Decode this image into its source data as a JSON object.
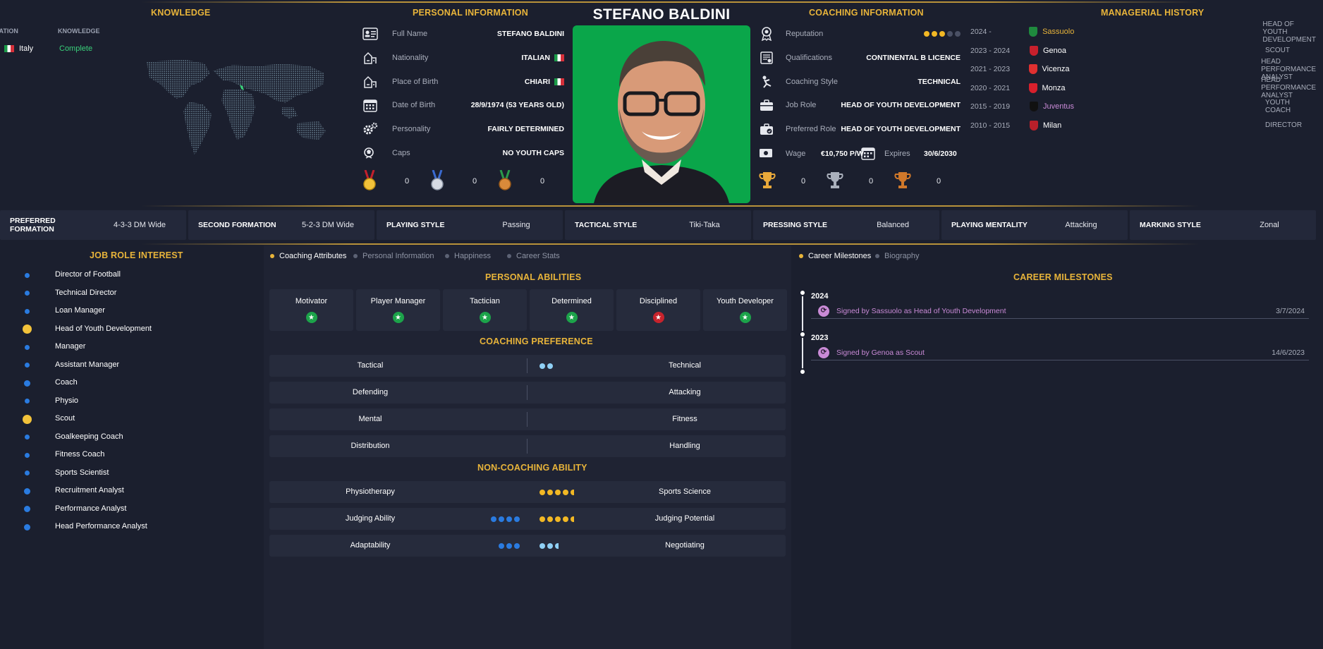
{
  "header": {
    "name": "STEFANO BALDINI"
  },
  "knowledge": {
    "title": "KNOWLEDGE",
    "col_nation": "NATION",
    "col_knowledge": "KNOWLEDGE",
    "rows": [
      {
        "nation": "Italy",
        "knowledge": "Complete"
      }
    ],
    "complete_color": "#39d07a"
  },
  "personal": {
    "title": "PERSONAL INFORMATION",
    "rows": [
      {
        "icon": "id-card-icon",
        "label": "Full Name",
        "value": "STEFANO BALDINI"
      },
      {
        "icon": "nationality-icon",
        "label": "Nationality",
        "value": "ITALIAN"
      },
      {
        "icon": "birthplace-icon",
        "label": "Place of Birth",
        "value": "CHIARI"
      },
      {
        "icon": "calendar-icon",
        "label": "Date of Birth",
        "value": "28/9/1974 (53 YEARS OLD)"
      },
      {
        "icon": "gears-icon",
        "label": "Personality",
        "value": "FAIRLY DETERMINED"
      },
      {
        "icon": "cap-icon",
        "label": "Caps",
        "value": "NO YOUTH CAPS"
      }
    ],
    "medals": [
      {
        "icon": "gold-medal-icon",
        "count": "0"
      },
      {
        "icon": "silver-medal-icon",
        "count": "0"
      },
      {
        "icon": "bronze-medal-icon",
        "count": "0"
      }
    ]
  },
  "coaching": {
    "title": "COACHING INFORMATION",
    "reputation_label": "Reputation",
    "reputation_stars": 3,
    "reputation_max": 5,
    "rows": [
      {
        "icon": "certificate-icon",
        "label": "Qualifications",
        "value": "CONTINENTAL B LICENCE"
      },
      {
        "icon": "whistle-icon",
        "label": "Coaching Style",
        "value": "TECHNICAL"
      },
      {
        "icon": "briefcase-icon",
        "label": "Job Role",
        "value": "HEAD OF YOUTH DEVELOPMENT"
      },
      {
        "icon": "preferred-briefcase-icon",
        "label": "Preferred Role",
        "value": "HEAD OF YOUTH DEVELOPMENT"
      }
    ],
    "wage_label": "Wage",
    "wage_value": "€10,750 P/W",
    "expires_label": "Expires",
    "expires_value": "30/6/2030",
    "trophies": [
      {
        "icon": "gold-trophy-icon",
        "count": "0"
      },
      {
        "icon": "silver-trophy-icon",
        "count": "0"
      },
      {
        "icon": "bronze-trophy-icon",
        "count": "0"
      }
    ]
  },
  "history": {
    "title": "MANAGERIAL HISTORY",
    "rows": [
      {
        "years": "2024 -",
        "club": "Sassuolo",
        "role": "HEAD OF YOUTH DEVELOPMENT",
        "club_color": "#e8b43a",
        "crest": "#1f8a3e"
      },
      {
        "years": "2023 - 2024",
        "club": "Genoa",
        "role": "SCOUT",
        "club_color": "#ffffff",
        "crest": "#c8202c"
      },
      {
        "years": "2021 - 2023",
        "club": "Vicenza",
        "role": "HEAD PERFORMANCE ANALYST",
        "club_color": "#ffffff",
        "crest": "#e03030"
      },
      {
        "years": "2020 - 2021",
        "club": "Monza",
        "role": "HEAD PERFORMANCE ANALYST",
        "club_color": "#ffffff",
        "crest": "#d8202c"
      },
      {
        "years": "2015 - 2019",
        "club": "Juventus",
        "role": "YOUTH COACH",
        "club_color": "#c98ad6",
        "crest": "#111111"
      },
      {
        "years": "2010 - 2015",
        "club": "Milan",
        "role": "DIRECTOR",
        "club_color": "#ffffff",
        "crest": "#b8202a"
      }
    ]
  },
  "tactics": [
    {
      "key": "PREFERRED FORMATION",
      "value": "4-3-3 DM Wide"
    },
    {
      "key": "SECOND FORMATION",
      "value": "5-2-3 DM Wide"
    },
    {
      "key": "PLAYING STYLE",
      "value": "Passing"
    },
    {
      "key": "TACTICAL STYLE",
      "value": "Tiki-Taka"
    },
    {
      "key": "PRESSING STYLE",
      "value": "Balanced"
    },
    {
      "key": "PLAYING MENTALITY",
      "value": "Attacking"
    },
    {
      "key": "MARKING STYLE",
      "value": "Zonal"
    }
  ],
  "job_role": {
    "title": "JOB ROLE INTEREST",
    "items": [
      {
        "label": "Director of Football",
        "level": "low"
      },
      {
        "label": "Technical Director",
        "level": "low"
      },
      {
        "label": "Loan Manager",
        "level": "low"
      },
      {
        "label": "Head of Youth Development",
        "level": "high"
      },
      {
        "label": "Manager",
        "level": "low"
      },
      {
        "label": "Assistant Manager",
        "level": "low"
      },
      {
        "label": "Coach",
        "level": "mid"
      },
      {
        "label": "Physio",
        "level": "low"
      },
      {
        "label": "Scout",
        "level": "high"
      },
      {
        "label": "Goalkeeping Coach",
        "level": "low"
      },
      {
        "label": "Fitness Coach",
        "level": "low"
      },
      {
        "label": "Sports Scientist",
        "level": "low"
      },
      {
        "label": "Recruitment Analyst",
        "level": "mid"
      },
      {
        "label": "Performance Analyst",
        "level": "mid"
      },
      {
        "label": "Head Performance Analyst",
        "level": "mid"
      }
    ]
  },
  "tabs_left": [
    "Coaching Attributes",
    "Personal Information",
    "Happiness",
    "Career Stats"
  ],
  "tabs_right": [
    "Career Milestones",
    "Biography"
  ],
  "abilities": {
    "title": "PERSONAL ABILITIES",
    "cards": [
      {
        "label": "Motivator",
        "good": true
      },
      {
        "label": "Player Manager",
        "good": true
      },
      {
        "label": "Tactician",
        "good": true
      },
      {
        "label": "Determined",
        "good": true
      },
      {
        "label": "Disciplined",
        "good": false
      },
      {
        "label": "Youth Developer",
        "good": true
      }
    ]
  },
  "coaching_pref": {
    "title": "COACHING PREFERENCE",
    "rows": [
      {
        "left": "Tactical",
        "right": "Technical",
        "left_pips": 0,
        "right_pips": 2
      },
      {
        "left": "Defending",
        "right": "Attacking",
        "left_pips": 0,
        "right_pips": 0
      },
      {
        "left": "Mental",
        "right": "Fitness",
        "left_pips": 0,
        "right_pips": 0
      },
      {
        "left": "Distribution",
        "right": "Handling",
        "left_pips": 0,
        "right_pips": 0
      }
    ]
  },
  "non_coaching": {
    "title": "NON-COACHING ABILITY",
    "rows": [
      {
        "left": "Physiotherapy",
        "right": "Sports Science",
        "left_pips": 0,
        "right_pips": 4.5,
        "left_color": "#2a7be0",
        "right_color": "#f2b824"
      },
      {
        "left": "Judging Ability",
        "right": "Judging Potential",
        "left_pips": 4,
        "right_pips": 4.5,
        "left_color": "#2a7be0",
        "right_color": "#f2b824"
      },
      {
        "left": "Adaptability",
        "right": "Negotiating",
        "left_pips": 3,
        "right_pips": 2.5,
        "left_color": "#2a7be0",
        "right_color": "#8fd0f5"
      }
    ]
  },
  "milestones": {
    "title": "CAREER MILESTONES",
    "entries": [
      {
        "year": "2024",
        "text": "Signed by Sassuolo as Head of Youth Development",
        "date": "3/7/2024"
      },
      {
        "year": "2023",
        "text": "Signed by Genoa as Scout",
        "date": "14/6/2023"
      }
    ]
  }
}
